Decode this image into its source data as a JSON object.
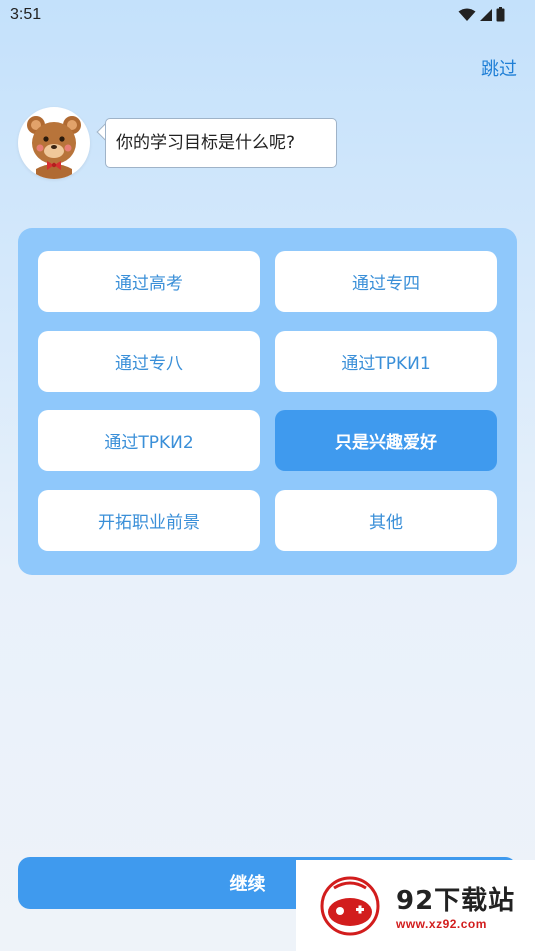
{
  "status_bar": {
    "time": "3:51",
    "icons": [
      "wifi-icon",
      "cell-signal-icon",
      "battery-icon"
    ]
  },
  "header": {
    "skip_label": "跳过"
  },
  "prompt": {
    "question": "你的学习目标是什么呢?",
    "avatar": "bear-mascot-icon"
  },
  "options": [
    {
      "label": "通过高考",
      "selected": false
    },
    {
      "label": "通过专四",
      "selected": false
    },
    {
      "label": "通过专八",
      "selected": false
    },
    {
      "label": "通过TPKИ1",
      "selected": false
    },
    {
      "label": "通过TPKИ2",
      "selected": false
    },
    {
      "label": "只是兴趣爱好",
      "selected": true
    },
    {
      "label": "开拓职业前景",
      "selected": false
    },
    {
      "label": "其他",
      "selected": false
    }
  ],
  "footer": {
    "continue_label": "继续"
  },
  "watermark": {
    "title": "92下载站",
    "url": "www.xz92.com"
  },
  "colors": {
    "accent": "#3f9aee",
    "panel": "#8fc8fb",
    "option_text": "#3a8fd8",
    "skip_text": "#1f7fd6",
    "watermark_red": "#d21d1d"
  }
}
